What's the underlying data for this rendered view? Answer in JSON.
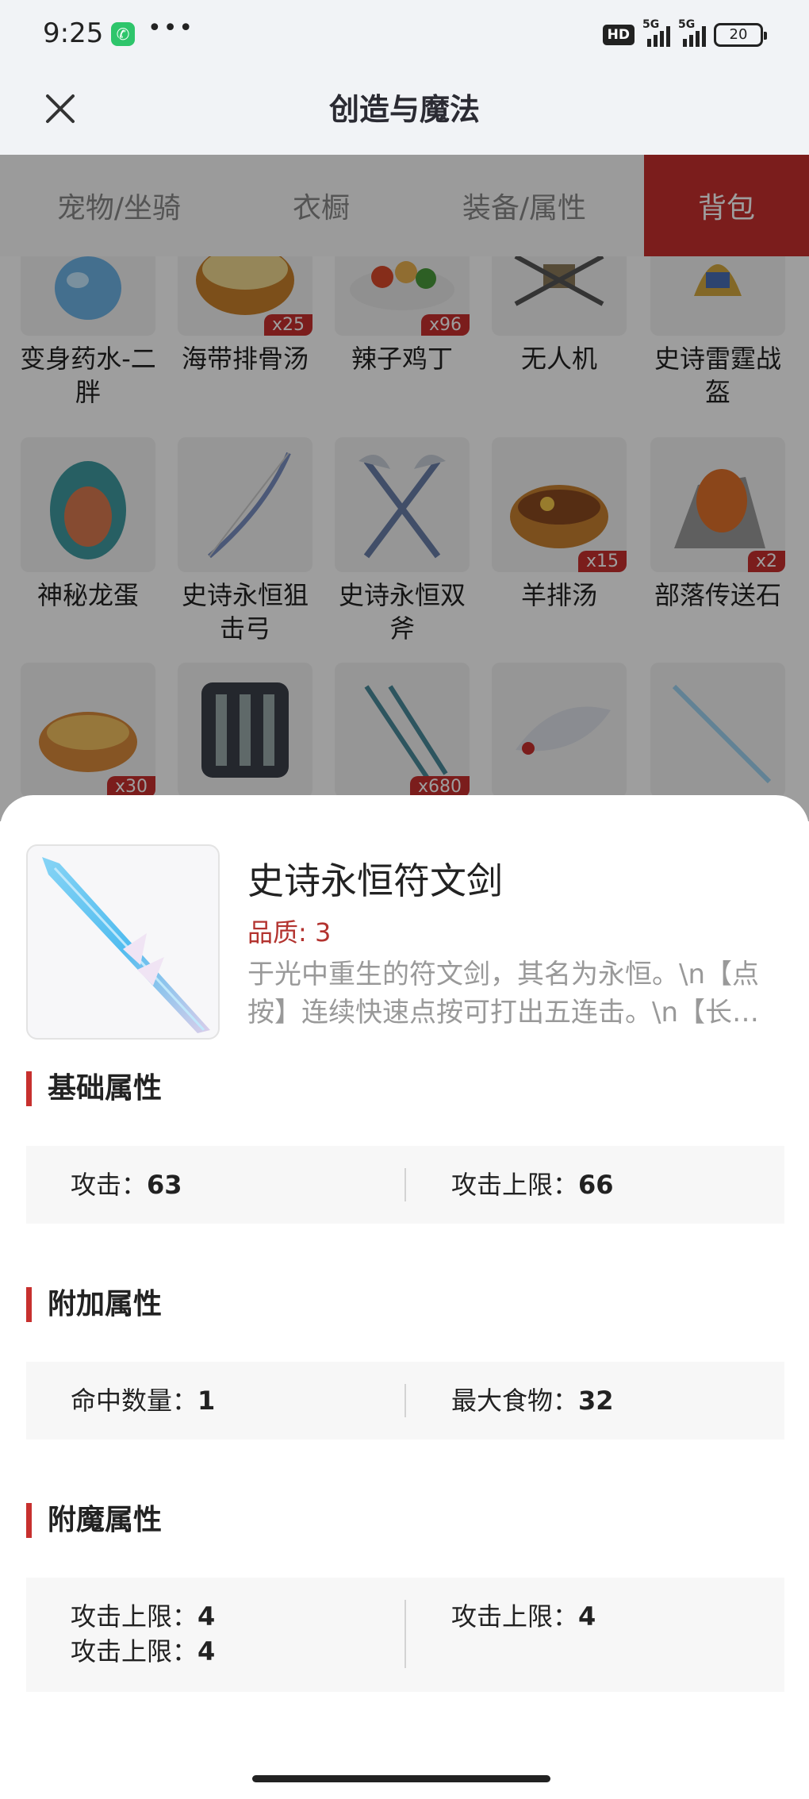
{
  "status_bar": {
    "time": "9:25",
    "icons": [
      "phone-call-icon",
      "more-dots-icon",
      "hd-badge-icon",
      "signal-5g-icon",
      "signal-5g-icon",
      "battery-icon"
    ],
    "hd_label": "HD",
    "network_label": "5G",
    "battery": "20"
  },
  "header": {
    "title": "创造与魔法",
    "close_icon": "close-icon"
  },
  "tabs": [
    {
      "label": "宠物/坐骑",
      "active": false
    },
    {
      "label": "衣橱",
      "active": false
    },
    {
      "label": "装备/属性",
      "active": false
    },
    {
      "label": "背包",
      "active": true
    }
  ],
  "grid": {
    "items": [
      {
        "name": "变身药水-二胖",
        "qty": ""
      },
      {
        "name": "海带排骨汤",
        "qty": "x25"
      },
      {
        "name": "辣子鸡丁",
        "qty": "x96"
      },
      {
        "name": "无人机",
        "qty": ""
      },
      {
        "name": "史诗雷霆战盔",
        "qty": ""
      },
      {
        "name": "神秘龙蛋",
        "qty": ""
      },
      {
        "name": "史诗永恒狙击弓",
        "qty": ""
      },
      {
        "name": "史诗永恒双斧",
        "qty": ""
      },
      {
        "name": "羊排汤",
        "qty": "x15"
      },
      {
        "name": "部落传送石",
        "qty": "x2"
      },
      {
        "name": "",
        "qty": "x30"
      },
      {
        "name": "",
        "qty": ""
      },
      {
        "name": "",
        "qty": "x680"
      },
      {
        "name": "",
        "qty": ""
      },
      {
        "name": "",
        "qty": ""
      }
    ]
  },
  "detail": {
    "name": "史诗永恒符文剑",
    "quality": "品质: 3",
    "description": "于光中重生的符文剑，其名为永恒。\\n【点按】连续快速点按可打出五连击。\\n【长…",
    "sections": {
      "basic": {
        "title": "基础属性",
        "left": {
          "label": "攻击：",
          "value": "63"
        },
        "right": {
          "label": "攻击上限：",
          "value": "66"
        }
      },
      "extra": {
        "title": "附加属性",
        "left": {
          "label": "命中数量：",
          "value": "1"
        },
        "right": {
          "label": "最大食物：",
          "value": "32"
        }
      },
      "enchant": {
        "title": "附魔属性",
        "left1": {
          "label": "攻击上限：",
          "value": "4"
        },
        "left2": {
          "label": "攻击上限：",
          "value": "4"
        },
        "right": {
          "label": "攻击上限：",
          "value": "4"
        }
      }
    }
  },
  "colors": {
    "accent": "#c7302e",
    "header_bg": "#f1f3f6",
    "attr_bg": "#f7f7f7"
  }
}
